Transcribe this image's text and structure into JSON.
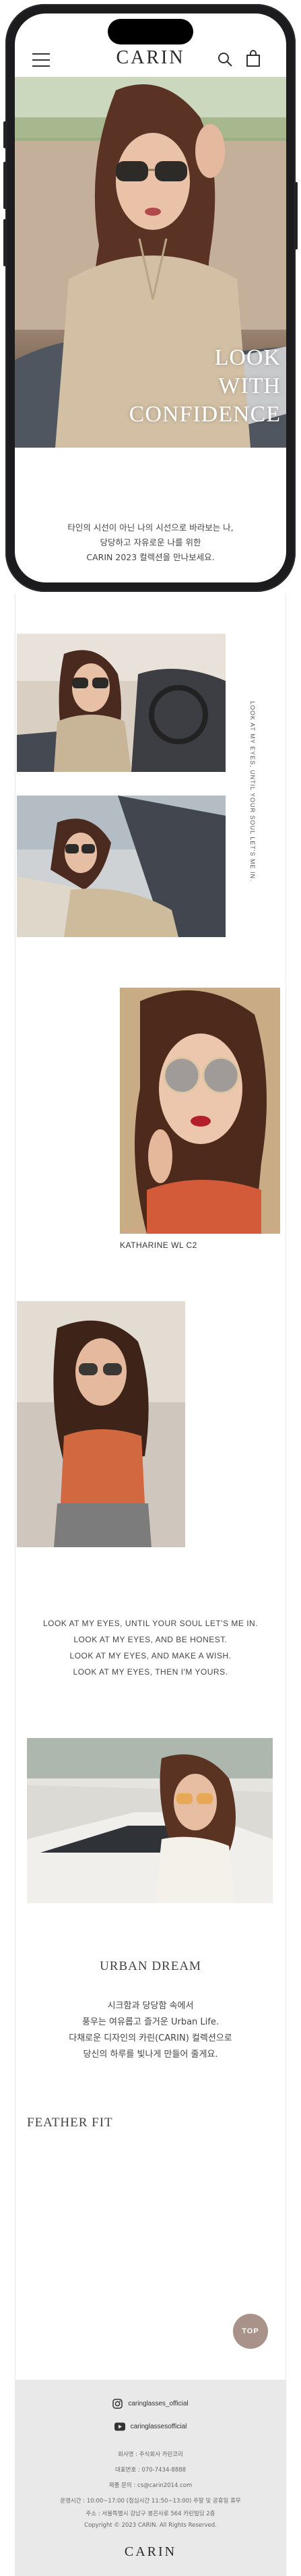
{
  "brand": {
    "name": "CARIN"
  },
  "hero": {
    "headline": [
      "LOOK",
      "WITH",
      "CONFIDENCE"
    ]
  },
  "intro": {
    "lines": [
      "타인의 시선이 아닌 나의 시선으로 바라보는 나,",
      "당당하고 자유로운 나를 위한",
      "CARIN 2023 컬렉션을 만나보세요."
    ]
  },
  "gallery": {
    "vertical_caption": "LOOK AT MY EYES, UNTIL YOUR SOUL LET'S ME IN.",
    "product_caption": "KATHARINE WL C2"
  },
  "quote": {
    "lines": [
      "LOOK AT MY EYES, UNTIL YOUR SOUL LET'S ME IN.",
      "LOOK AT MY EYES, AND BE HONEST.",
      "LOOK AT MY EYES, AND MAKE A WISH.",
      "LOOK AT MY EYES, THEN I'M YOURS."
    ]
  },
  "urban": {
    "title": "URBAN DREAM",
    "lines": [
      "시크함과 당당함 속에서",
      "풍우는 여유롭고 즐거운 Urban Life.",
      "다채로운 디자인의 카린(CARIN) 컬렉션으로",
      "당신의 하루를 빛나게 만들어 줄게요."
    ]
  },
  "feather": {
    "title": "FEATHER FIT"
  },
  "top_button": {
    "label": "TOP"
  },
  "footer": {
    "social": [
      {
        "icon": "instagram-icon",
        "handle": "caringlasses_official"
      },
      {
        "icon": "youtube-icon",
        "handle": "caringlassesofficial"
      }
    ],
    "info": [
      "회사명 : 주식회사 카린코리",
      "대표번호 : 070-7434-8888",
      "제품 문의 : cs@carin2014.com",
      "운영시간 : 10:00~17:00 (점심시간 11:50~13:00) 주말 및 공휴일 휴무",
      "주소 : 서울특별시 강남구 봉은사로 564 카린빌딩 2층",
      "Copyright © 2023 CARIN. All Rights Reserved."
    ],
    "logo": "CARIN"
  },
  "colors": {
    "hero_text": "#ffffff",
    "footer_bg": "#e9e9e9",
    "top_button": "#a8928a",
    "phone_frame": "#1c1c1e"
  }
}
